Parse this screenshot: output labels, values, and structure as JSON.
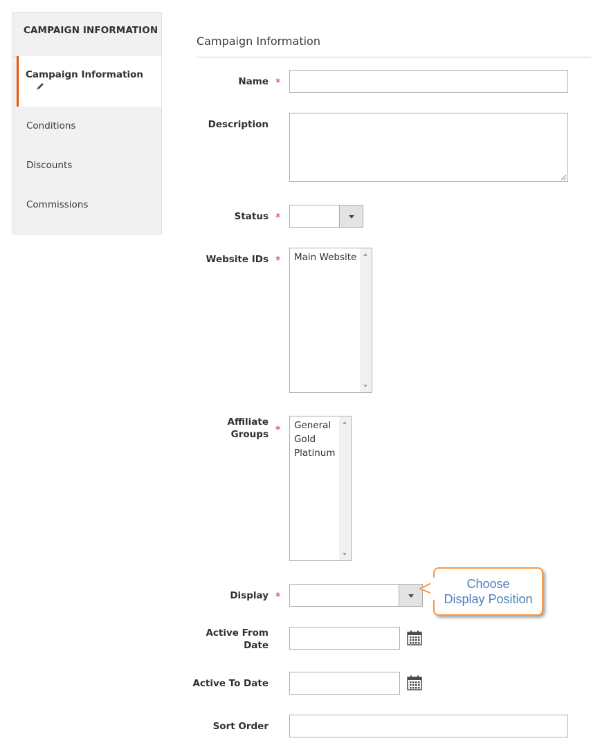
{
  "sidebar": {
    "title": "CAMPAIGN INFORMATION",
    "items": [
      {
        "label": "Campaign Information",
        "active": true
      },
      {
        "label": "Conditions"
      },
      {
        "label": "Discounts"
      },
      {
        "label": "Commissions"
      }
    ]
  },
  "section": {
    "title": "Campaign Information"
  },
  "form": {
    "name": {
      "label": "Name",
      "required": "*",
      "value": ""
    },
    "description": {
      "label": "Description",
      "value": ""
    },
    "status": {
      "label": "Status",
      "required": "*",
      "value": ""
    },
    "website_ids": {
      "label": "Website IDs",
      "required": "*",
      "options": [
        "Main Website"
      ]
    },
    "affiliate_groups": {
      "label_line1": "Affiliate",
      "label_line2": "Groups",
      "required": "*",
      "options": [
        "General",
        "Gold",
        "Platinum"
      ]
    },
    "display": {
      "label": "Display",
      "required": "*",
      "value": ""
    },
    "active_from": {
      "label_line1": "Active From",
      "label_line2": "Date",
      "value": ""
    },
    "active_to": {
      "label": "Active To Date",
      "value": ""
    },
    "sort_order": {
      "label": "Sort Order",
      "value": ""
    }
  },
  "callout": {
    "line1": "Choose",
    "line2": "Display Position"
  },
  "icons": {
    "edit": "pencil-icon",
    "calendar": "calendar-icon"
  },
  "colors": {
    "accent": "#eb5202",
    "required": "#e22626",
    "callout_border": "#f79646",
    "callout_text": "#4f81bd"
  }
}
